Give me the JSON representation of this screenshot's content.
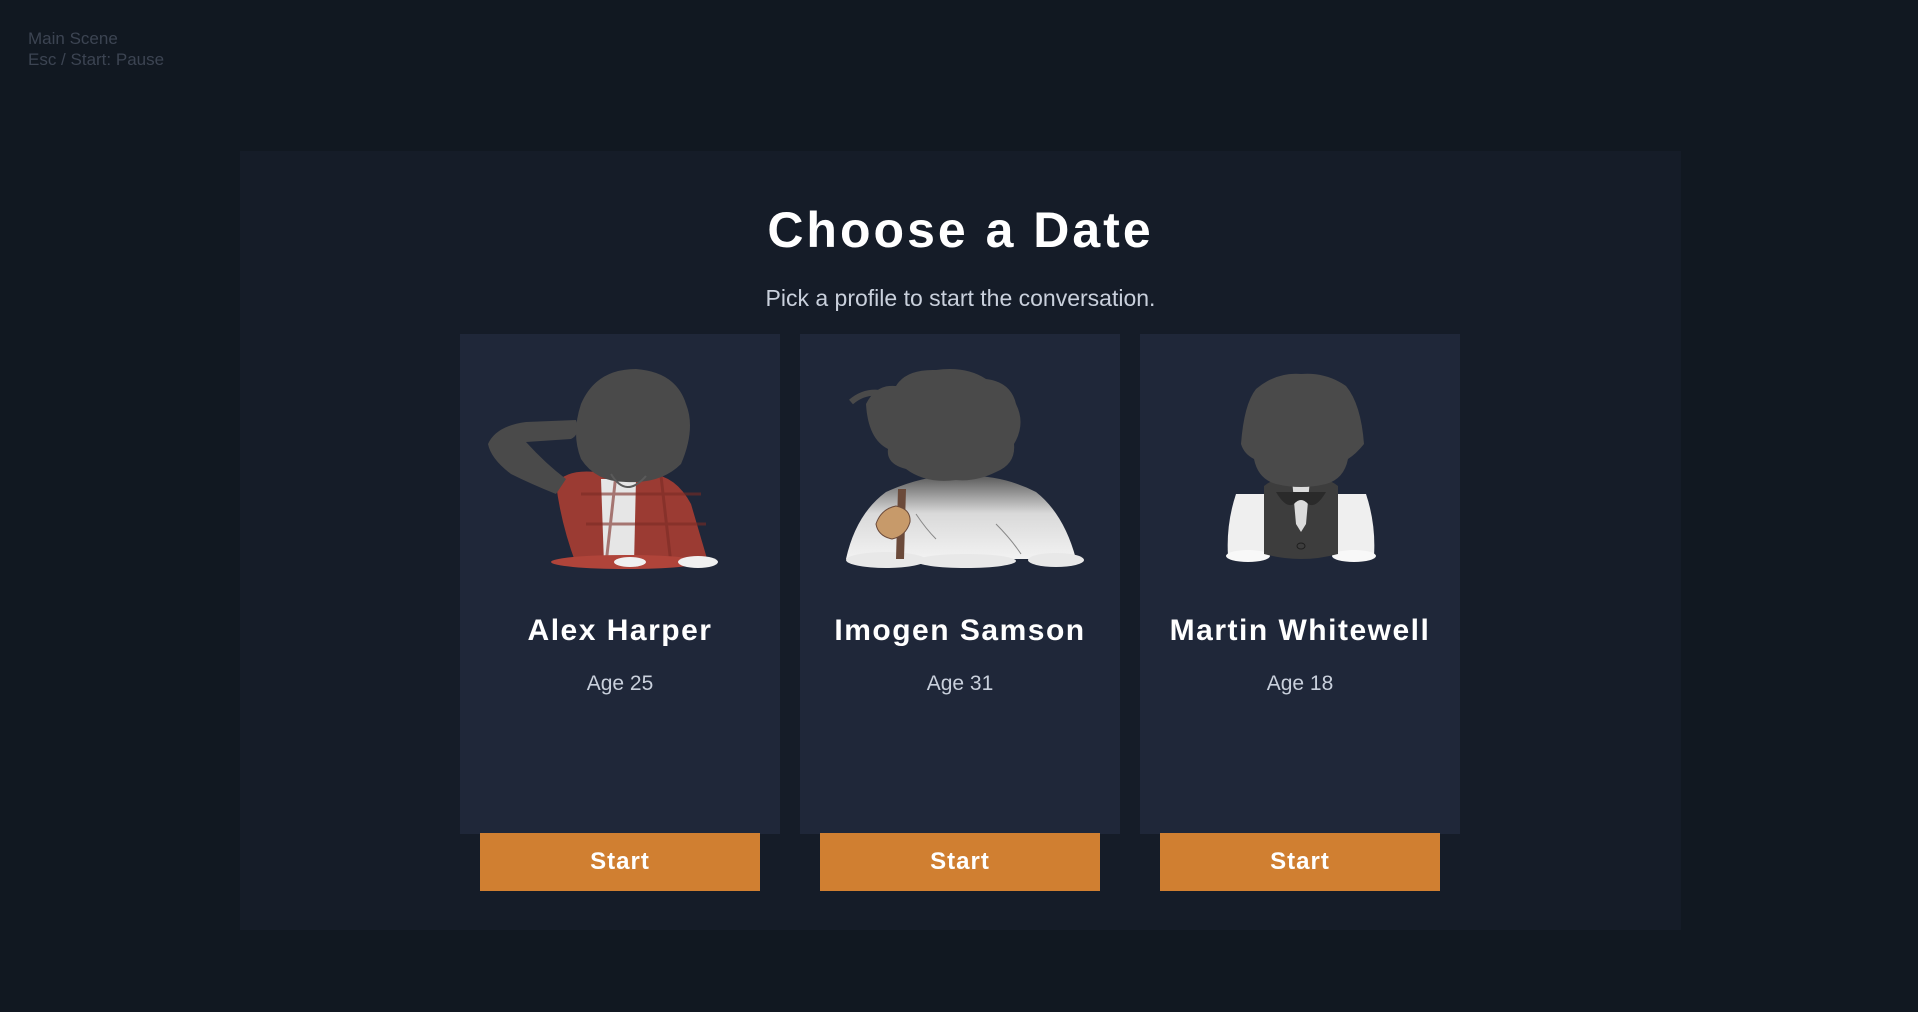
{
  "debug": {
    "scene": "Main Scene",
    "hint": "Esc / Start: Pause"
  },
  "dialog": {
    "title": "Choose a Date",
    "subtitle": "Pick a profile to start the conversation."
  },
  "profiles": [
    {
      "name": "Alex Harper",
      "age": "Age 25",
      "start_label": "Start",
      "portrait_icon": "character-portrait-alex"
    },
    {
      "name": "Imogen Samson",
      "age": "Age 31",
      "start_label": "Start",
      "portrait_icon": "character-portrait-imogen"
    },
    {
      "name": "Martin Whitewell",
      "age": "Age 18",
      "start_label": "Start",
      "portrait_icon": "character-portrait-martin"
    }
  ],
  "colors": {
    "background": "#111821",
    "panel": "#151c28",
    "card": "#1f2739",
    "button": "#d07f31",
    "text": "#ffffff",
    "muted_text": "#c9d0dc"
  }
}
